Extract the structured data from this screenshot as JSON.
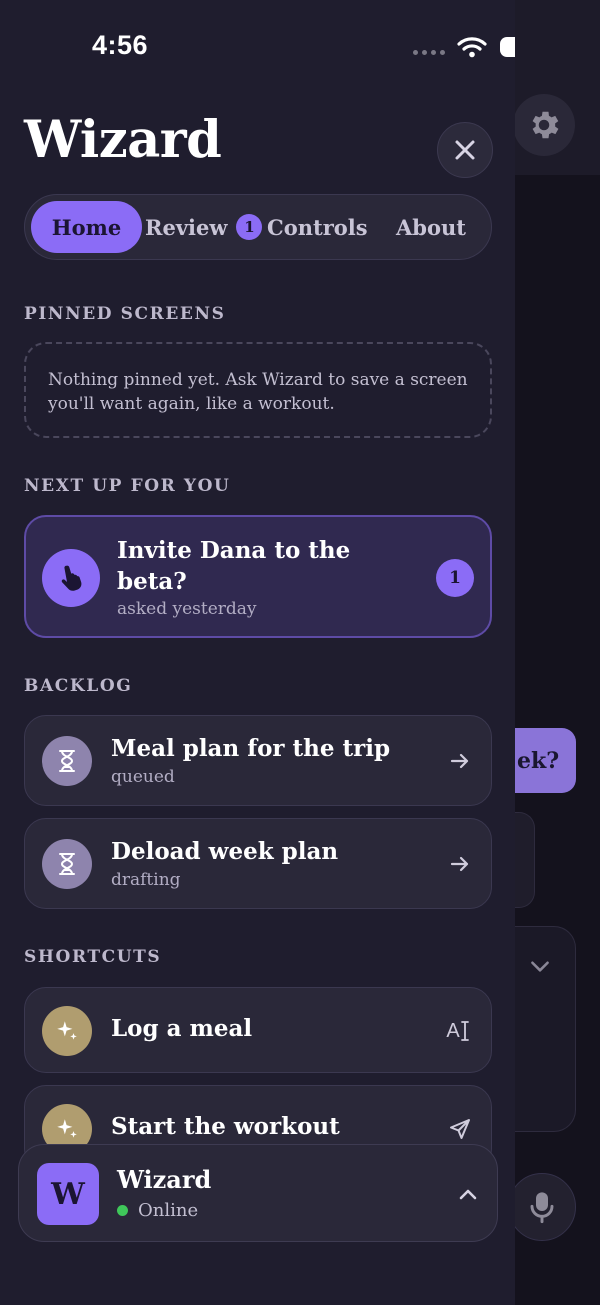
{
  "status_bar": {
    "time": "4:56"
  },
  "drawer": {
    "title": "Wizard",
    "tabs": [
      {
        "label": "Home",
        "active": true
      },
      {
        "label": "Review",
        "badge": "1"
      },
      {
        "label": "Controls"
      },
      {
        "label": "About"
      }
    ],
    "sections": {
      "pinned": "PINNED SCREENS",
      "next_up": "NEXT UP FOR YOU",
      "backlog": "BACKLOG",
      "shortcuts": "SHORTCUTS"
    },
    "pinned_empty": "Nothing pinned yet. Ask Wizard to save a screen you'll want again, like a workout.",
    "next_up": {
      "title": "Invite Dana to the beta?",
      "subtitle": "asked yesterday",
      "badge": "1",
      "icon": "hand-pointer-icon"
    },
    "backlog": [
      {
        "title": "Meal plan for the trip",
        "status": "queued",
        "icon": "hourglass-icon",
        "trail": "arrow-right-icon"
      },
      {
        "title": "Deload week plan",
        "status": "drafting",
        "icon": "hourglass-icon",
        "trail": "arrow-right-icon"
      }
    ],
    "shortcuts": [
      {
        "title": "Log a meal",
        "icon": "sparkles-icon",
        "trail": "text-input-icon",
        "trail_text": "A"
      },
      {
        "title": "Start the workout",
        "icon": "sparkles-icon",
        "trail": "send-icon"
      }
    ],
    "footer": {
      "avatar": "W",
      "name": "Wizard",
      "status": "Online"
    }
  },
  "background": {
    "bubble_text": "ek?"
  },
  "colors": {
    "accent": "#8b6cf6",
    "drawer_bg": "#1f1d2e",
    "online": "#3fc75a",
    "shortcut_icon": "#b09d6f",
    "backlog_icon": "#8e84ad"
  }
}
